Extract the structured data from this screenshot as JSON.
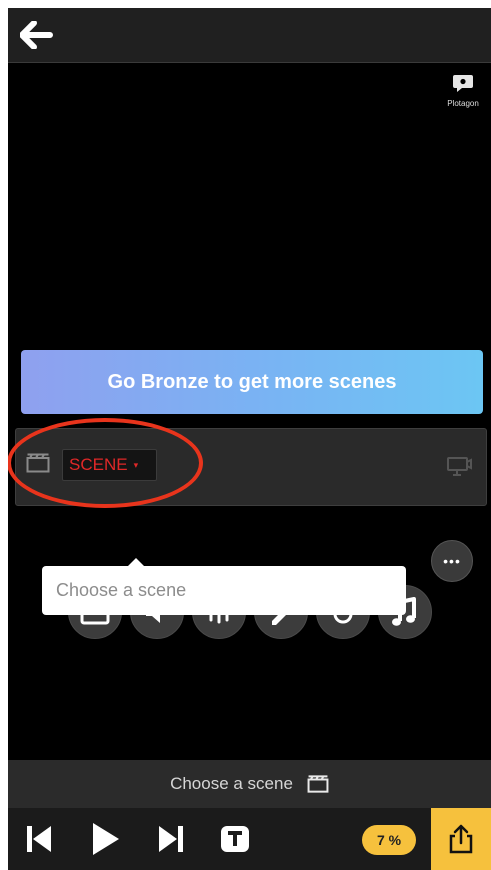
{
  "header": {
    "back_icon": "arrow-left-icon"
  },
  "logo": {
    "text": "Plotagon"
  },
  "upgrade": {
    "text": "Go Bronze to get more scenes"
  },
  "scene_bar": {
    "select_label": "SCENE",
    "caret": "▾",
    "more_label": "•••"
  },
  "tooltip": {
    "text": "Choose a scene"
  },
  "status": {
    "text": "Choose a scene"
  },
  "controls": {
    "progress_label": "7 %"
  },
  "colors": {
    "accent": "#f6c13d",
    "scene_red": "#e02828",
    "highlight_ring": "#e8341c"
  }
}
